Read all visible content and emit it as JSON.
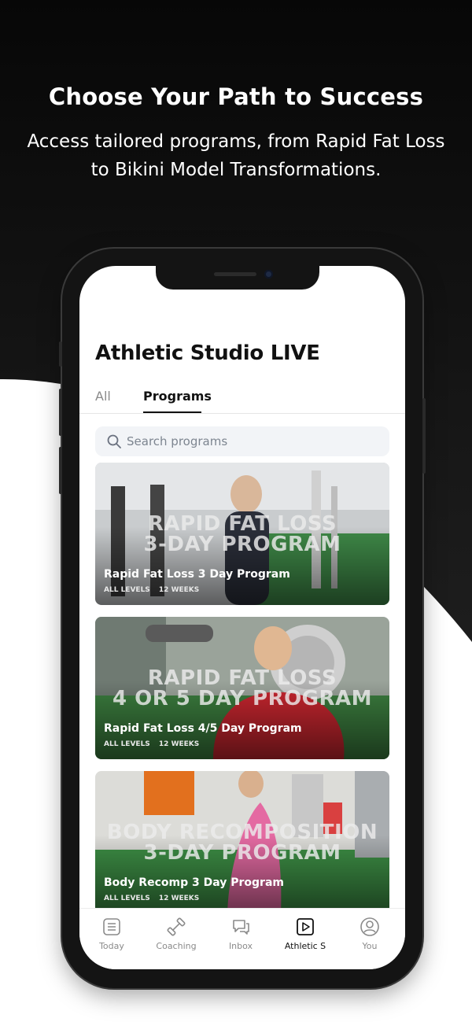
{
  "promo": {
    "headline": "Choose Your Path to Success",
    "subline": "Access tailored programs, from Rapid Fat Loss to Bikini Model Transformations."
  },
  "app": {
    "title": "Athletic Studio LIVE",
    "tabs": [
      {
        "label": "All",
        "active": false
      },
      {
        "label": "Programs",
        "active": true
      }
    ],
    "search": {
      "placeholder": "Search programs"
    },
    "programs": [
      {
        "overlay_line1": "RAPID FAT LOSS",
        "overlay_line2": "3-DAY PROGRAM",
        "title": "Rapid Fat Loss 3 Day Program",
        "level": "ALL LEVELS",
        "duration": "12 WEEKS",
        "accent": "#2e7d3a"
      },
      {
        "overlay_line1": "RAPID FAT LOSS",
        "overlay_line2": "4 OR 5 DAY PROGRAM",
        "title": "Rapid Fat Loss 4/5 Day Program",
        "level": "ALL LEVELS",
        "duration": "12 WEEKS",
        "accent": "#c62828"
      },
      {
        "overlay_line1": "BODY RECOMPOSITION",
        "overlay_line2": "3-DAY PROGRAM",
        "title": "Body Recomp 3 Day Program",
        "level": "ALL LEVELS",
        "duration": "12 WEEKS",
        "accent": "#e84a8a"
      }
    ],
    "bottom_nav": [
      {
        "label": "Today",
        "icon": "list-icon",
        "active": false
      },
      {
        "label": "Coaching",
        "icon": "dumbbell-icon",
        "active": false
      },
      {
        "label": "Inbox",
        "icon": "chat-icon",
        "active": false
      },
      {
        "label": "Athletic S",
        "icon": "play-icon",
        "active": true
      },
      {
        "label": "You",
        "icon": "user-icon",
        "active": false
      }
    ]
  },
  "colors": {
    "background_dark": "#111111",
    "text_primary": "#111111",
    "text_muted": "#8a8a8a",
    "search_bg": "#f2f4f7"
  }
}
